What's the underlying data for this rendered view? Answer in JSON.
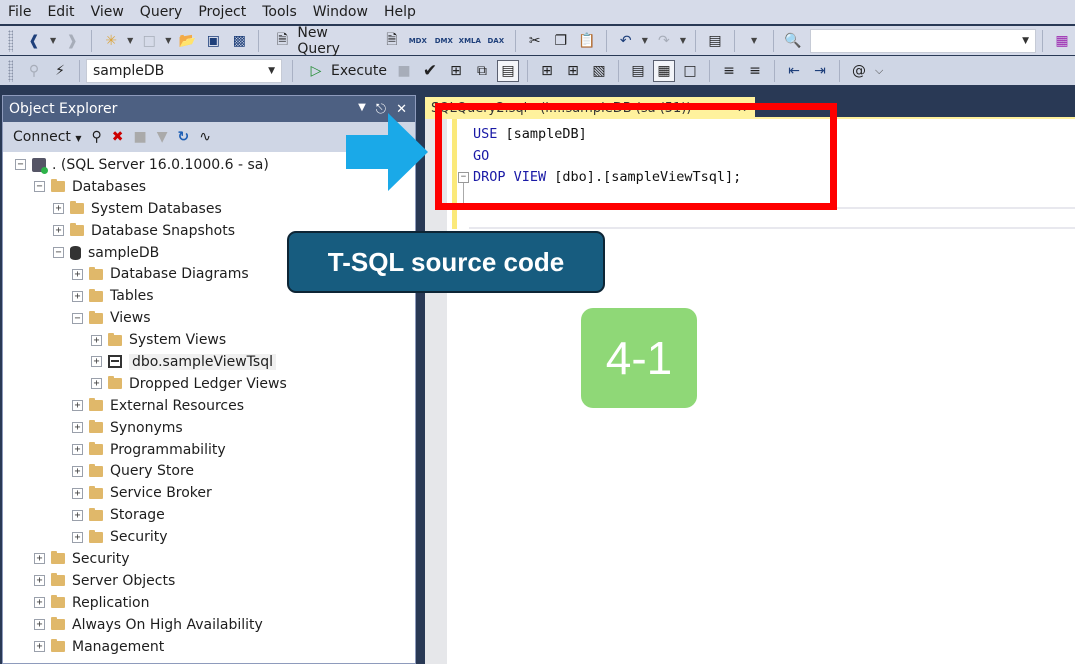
{
  "menu": [
    "File",
    "Edit",
    "View",
    "Query",
    "Project",
    "Tools",
    "Window",
    "Help"
  ],
  "toolbar1": {
    "new_query_label": "New Query",
    "script_labels": [
      "MDX",
      "DMX",
      "XMLA",
      "DAX"
    ],
    "search_combo_value": ""
  },
  "toolbar2": {
    "database_selected": "sampleDB",
    "execute_label": "Execute"
  },
  "object_explorer": {
    "title": "Object Explorer",
    "connect_label": "Connect",
    "tree": [
      {
        "label": ". (SQL Server 16.0.1000.6 - sa)",
        "level": 0,
        "expander": "-",
        "icon": "server"
      },
      {
        "label": "Databases",
        "level": 1,
        "expander": "-",
        "icon": "folder"
      },
      {
        "label": "System Databases",
        "level": 2,
        "expander": "+",
        "icon": "folder"
      },
      {
        "label": "Database Snapshots",
        "level": 2,
        "expander": "+",
        "icon": "folder"
      },
      {
        "label": "sampleDB",
        "level": 2,
        "expander": "-",
        "icon": "database"
      },
      {
        "label": "Database Diagrams",
        "level": 3,
        "expander": "+",
        "icon": "folder"
      },
      {
        "label": "Tables",
        "level": 3,
        "expander": "+",
        "icon": "folder"
      },
      {
        "label": "Views",
        "level": 3,
        "expander": "-",
        "icon": "folder"
      },
      {
        "label": "System Views",
        "level": 4,
        "expander": "+",
        "icon": "folder"
      },
      {
        "label": "dbo.sampleViewTsql",
        "level": 4,
        "expander": "+",
        "icon": "view",
        "highlighted": true
      },
      {
        "label": "Dropped Ledger Views",
        "level": 4,
        "expander": "+",
        "icon": "folder"
      },
      {
        "label": "External Resources",
        "level": 3,
        "expander": "+",
        "icon": "folder"
      },
      {
        "label": "Synonyms",
        "level": 3,
        "expander": "+",
        "icon": "folder"
      },
      {
        "label": "Programmability",
        "level": 3,
        "expander": "+",
        "icon": "folder"
      },
      {
        "label": "Query Store",
        "level": 3,
        "expander": "+",
        "icon": "folder"
      },
      {
        "label": "Service Broker",
        "level": 3,
        "expander": "+",
        "icon": "folder"
      },
      {
        "label": "Storage",
        "level": 3,
        "expander": "+",
        "icon": "folder"
      },
      {
        "label": "Security",
        "level": 3,
        "expander": "+",
        "icon": "folder"
      },
      {
        "label": "Security",
        "level": 1,
        "expander": "+",
        "icon": "folder"
      },
      {
        "label": "Server Objects",
        "level": 1,
        "expander": "+",
        "icon": "folder"
      },
      {
        "label": "Replication",
        "level": 1,
        "expander": "+",
        "icon": "folder"
      },
      {
        "label": "Always On High Availability",
        "level": 1,
        "expander": "+",
        "icon": "folder"
      },
      {
        "label": "Management",
        "level": 1,
        "expander": "+",
        "icon": "folder"
      }
    ]
  },
  "editor": {
    "tab_label": "SQLQuery2.sql - (l....sampleDB (sa (51))",
    "code_lines": [
      [
        {
          "t": "USE",
          "kw": true
        },
        {
          "t": " [sampleDB]",
          "kw": false
        }
      ],
      [
        {
          "t": "GO",
          "kw": true
        }
      ],
      [
        {
          "t": "DROP",
          "kw": true
        },
        {
          "t": " ",
          "kw": false
        },
        {
          "t": "VIEW",
          "kw": true
        },
        {
          "t": " [dbo].[sampleViewTsql];",
          "kw": false
        }
      ],
      []
    ]
  },
  "annotations": {
    "callout_text": "T-SQL source code",
    "step_badge": "4-1",
    "colors": {
      "highlight_box": "#ff0000",
      "arrow": "#1aa9e8",
      "callout_bg": "#175c7f",
      "badge_bg": "#8fd877"
    }
  }
}
